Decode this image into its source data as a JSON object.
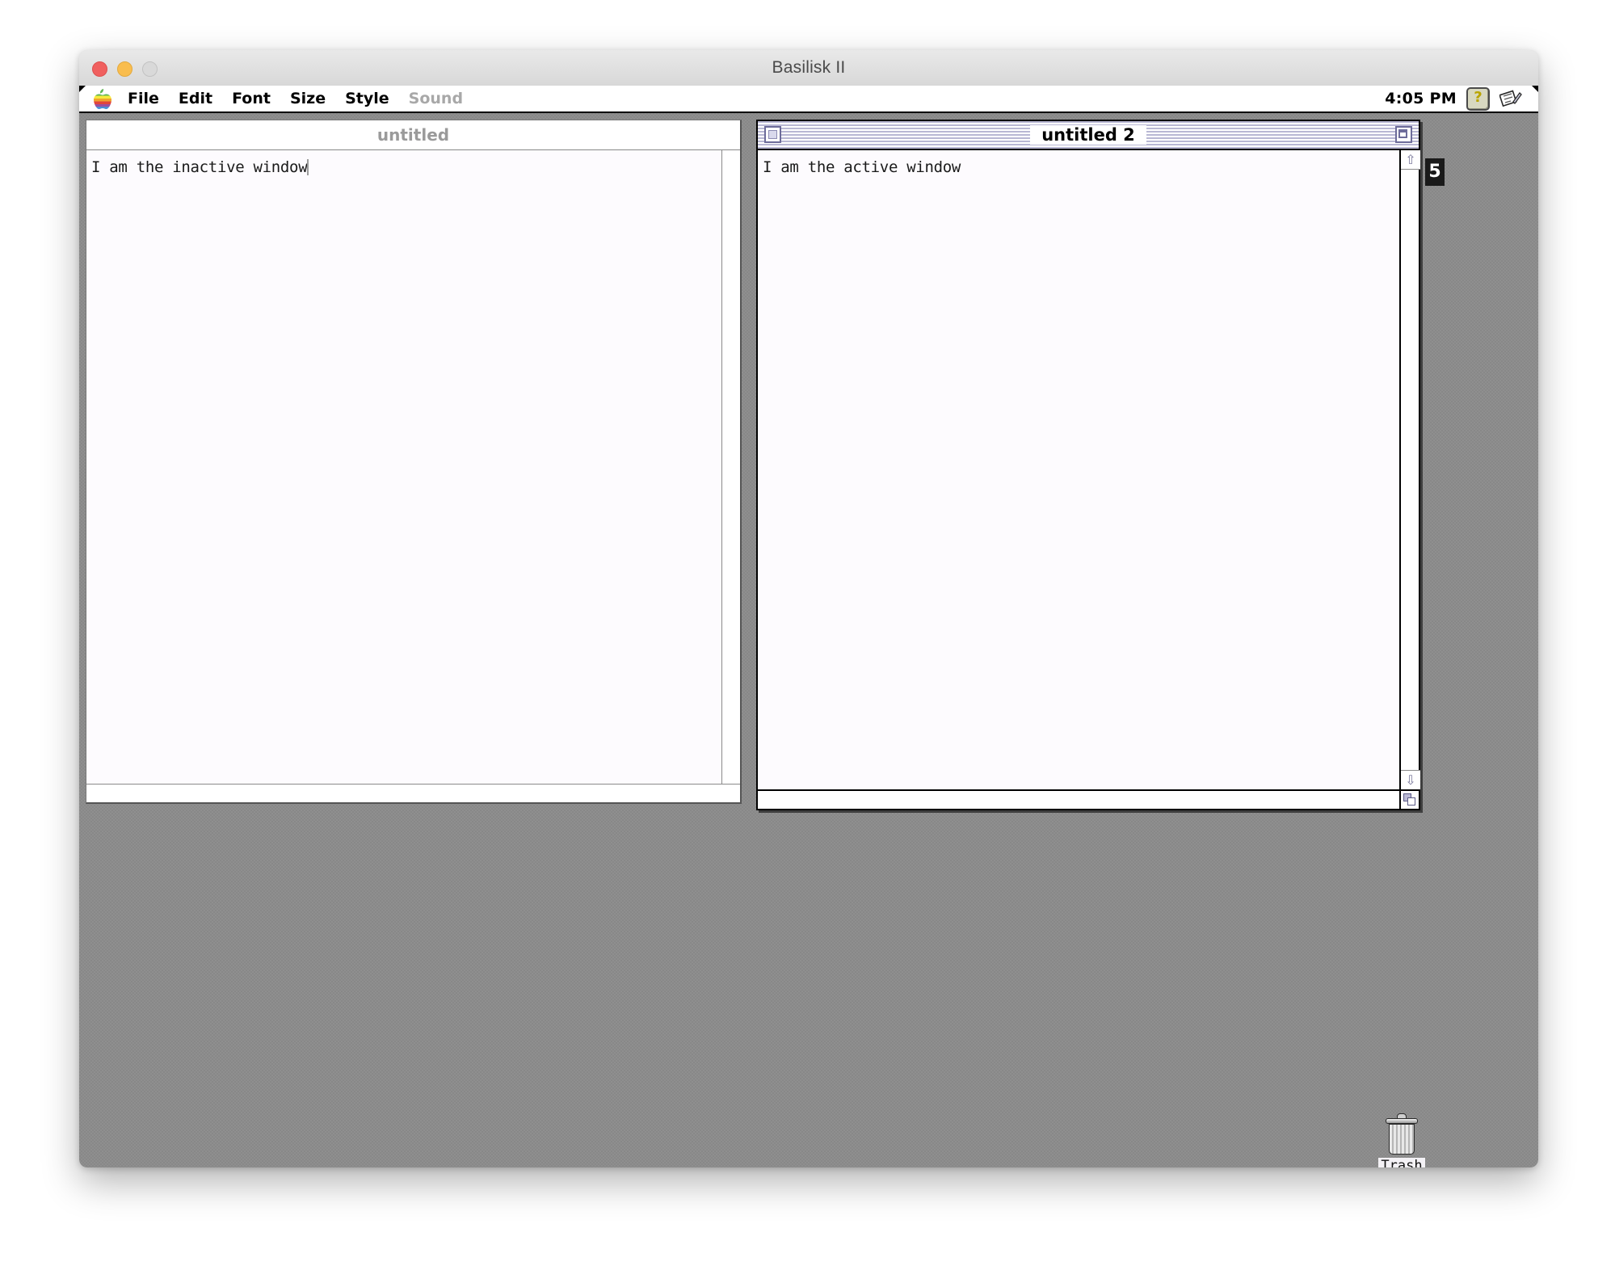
{
  "host": {
    "title": "Basilisk II",
    "traffic_lights": [
      "close",
      "minimize",
      "zoom"
    ]
  },
  "menubar": {
    "apple_icon": "apple-logo-rainbow",
    "items": [
      {
        "label": "File",
        "enabled": true
      },
      {
        "label": "Edit",
        "enabled": true
      },
      {
        "label": "Font",
        "enabled": true
      },
      {
        "label": "Size",
        "enabled": true
      },
      {
        "label": "Style",
        "enabled": true
      },
      {
        "label": "Sound",
        "enabled": false
      }
    ],
    "clock": "4:05 PM",
    "help_glyph": "?",
    "app_menu_icon": "simpletext-app-icon"
  },
  "windows": {
    "inactive": {
      "title": "untitled",
      "body_text": "I am the inactive window",
      "has_caret": true,
      "state": "inactive"
    },
    "active": {
      "title": "untitled 2",
      "body_text": "I am the active window",
      "state": "active",
      "close_box": "close-box",
      "zoom_box": "zoom-box",
      "scroll_up_glyph": "⇧",
      "scroll_down_glyph": "⇩",
      "grow_box": "grow-box"
    }
  },
  "desktop": {
    "edge_badge": "5",
    "trash_label": "Trash",
    "pattern": "gray-dither"
  },
  "colors": {
    "desktop_gray": "#8f8f8f",
    "title_stripe": "#b9b8d4",
    "widget_purple": "#6d6c9a",
    "menubar_bg": "#ffffff",
    "doc_bg": "#fdfbfe"
  }
}
